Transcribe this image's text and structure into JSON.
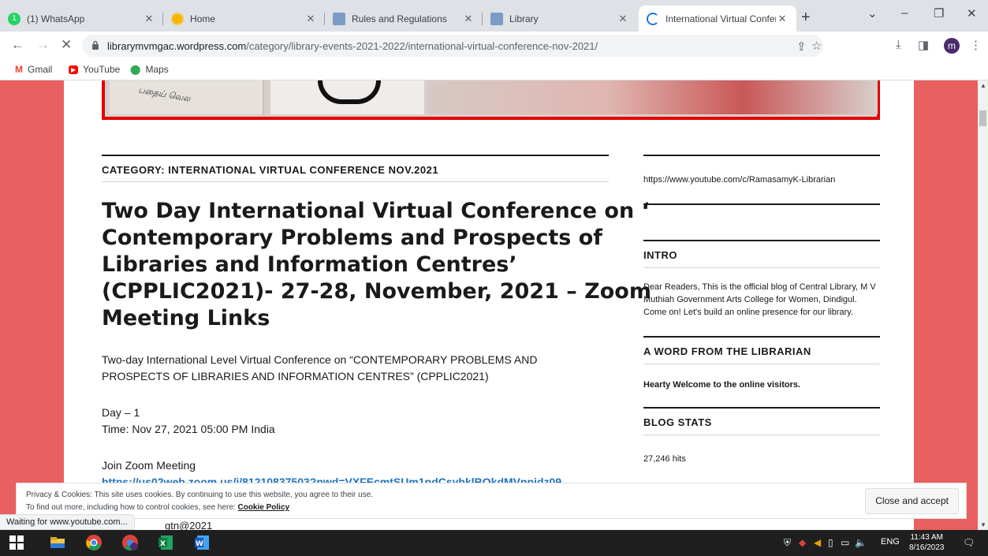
{
  "browser": {
    "tabs": [
      {
        "title": "(1) WhatsApp",
        "favicon": "whatsapp-icon",
        "color": "#25d366"
      },
      {
        "title": "Home",
        "favicon": "wordpress-site-icon",
        "color": "#f5b400"
      },
      {
        "title": "Rules and Regulations",
        "favicon": "site-icon",
        "color": "#7a9cc6"
      },
      {
        "title": "Library",
        "favicon": "site-icon",
        "color": "#7a9cc6"
      },
      {
        "title": "International Virtual Confere",
        "favicon": "loading-icon",
        "color": "#1a73e8"
      }
    ],
    "url_host": "librarymvmgac.wordpress.com",
    "url_path": "/category/library-events-2021-2022/international-virtual-conference-nov-2021/",
    "avatar_letter": "m",
    "bookmarks": [
      {
        "label": "Gmail",
        "icon": "gmail-icon"
      },
      {
        "label": "YouTube",
        "icon": "youtube-icon"
      },
      {
        "label": "Maps",
        "icon": "maps-icon"
      }
    ],
    "status_text": "Waiting for www.youtube.com..."
  },
  "banner": {
    "seal_text": "பதைய் வெல"
  },
  "main": {
    "category_heading": "CATEGORY: INTERNATIONAL VIRTUAL CONFERENCE NOV.2021",
    "title_lines": [
      "Two Day International Virtual Conference on ‘",
      "Contemporary Problems and Prospects of",
      "Libraries and Information Centres’",
      "(CPPLIC2021)- 27-28, November, 2021 – Zoom",
      "Meeting Links"
    ],
    "intro_line1": "Two-day International Level Virtual Conference on “CONTEMPORARY PROBLEMS AND",
    "intro_line2": "PROSPECTS OF LIBRARIES AND INFORMATION CENTRES” (CPPLIC2021)",
    "day_label": "Day – 1",
    "time_label": "Time: Nov 27, 2021 05:00 PM India",
    "join_label": "Join Zoom Meeting",
    "zoom_link": "https://us02web.zoom.us/j/81210837503?pwd=VXFEcmtSUm1pdCsybklBQkdMVnpidz09",
    "partial_text": "gtn@2021"
  },
  "sidebar": {
    "youtube_link": "https://www.youtube.com/c/RamasamyK-Librarian",
    "intro_title": "INTRO",
    "intro_text": "Dear Readers, This is the official blog of Central Library, M V Muthiah Government Arts College for Women, Dindigul. Come on! Let's build an online presence for our library.",
    "librarian_title": "A WORD FROM THE LIBRARIAN",
    "librarian_text": "Hearty Welcome to the online visitors.",
    "stats_title": "BLOG STATS",
    "stats_text": "27,246 hits"
  },
  "cookie": {
    "line1": "Privacy & Cookies: This site uses cookies. By continuing to use this website, you agree to their use.",
    "line2_prefix": "To find out more, including how to control cookies, see here: ",
    "policy_link": "Cookie Policy",
    "accept_label": "Close and accept"
  },
  "taskbar": {
    "language": "ENG",
    "time": "11:43 AM",
    "date": "8/16/2023"
  }
}
